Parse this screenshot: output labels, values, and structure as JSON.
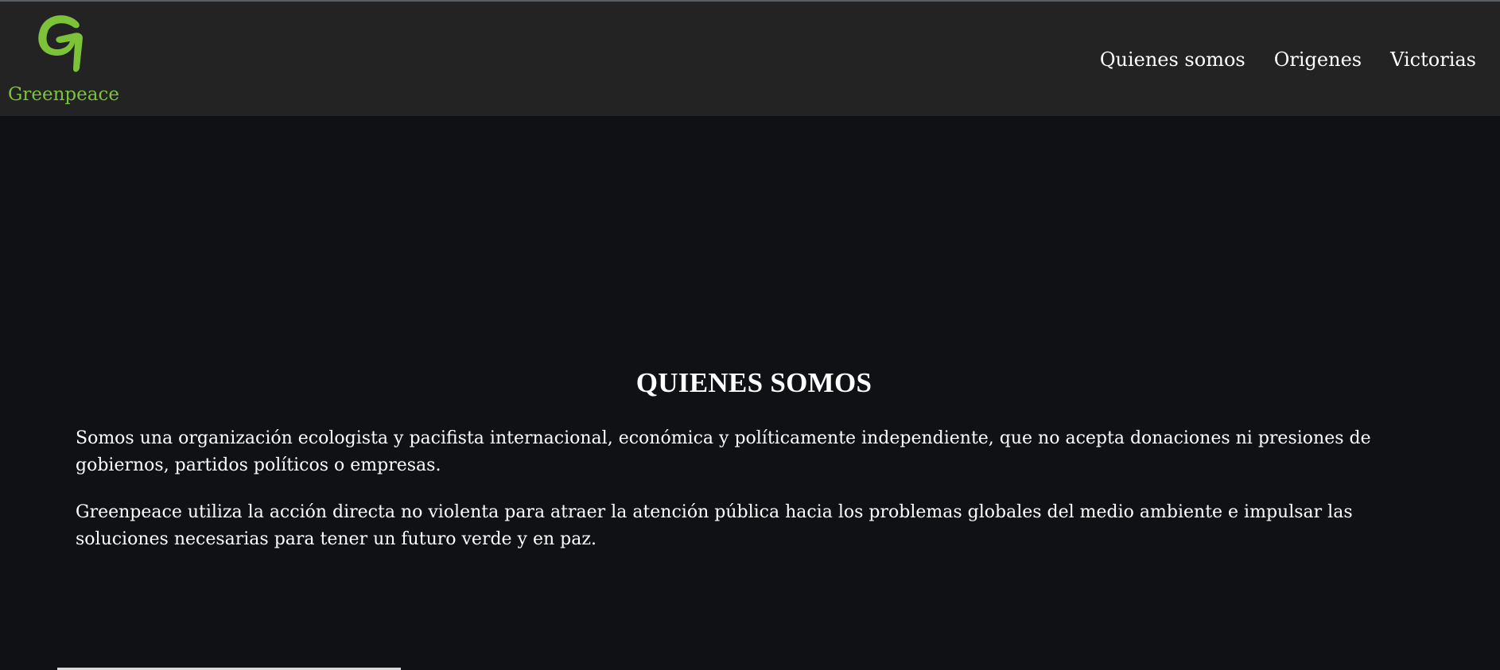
{
  "colors": {
    "accent_green": "#7cc33a",
    "header_bg": "#232323",
    "page_bg": "#0f1115",
    "text": "#ffffff"
  },
  "header": {
    "logo_icon": "greenpeace-g-logo-icon",
    "logo_text": "Greenpeace",
    "nav": [
      {
        "label": "Quienes somos"
      },
      {
        "label": "Origenes"
      },
      {
        "label": "Victorias"
      }
    ]
  },
  "main": {
    "title": "QUIENES SOMOS",
    "paragraphs": [
      "Somos una organización ecologista y pacifista internacional, económica y políticamente independiente, que no acepta donaciones ni presiones de gobiernos, partidos políticos o empresas.",
      "Greenpeace utiliza la acción directa no violenta para atraer la atención pública hacia los problemas globales del medio ambiente e impulsar las soluciones necesarias para tener un futuro verde y en paz."
    ]
  }
}
